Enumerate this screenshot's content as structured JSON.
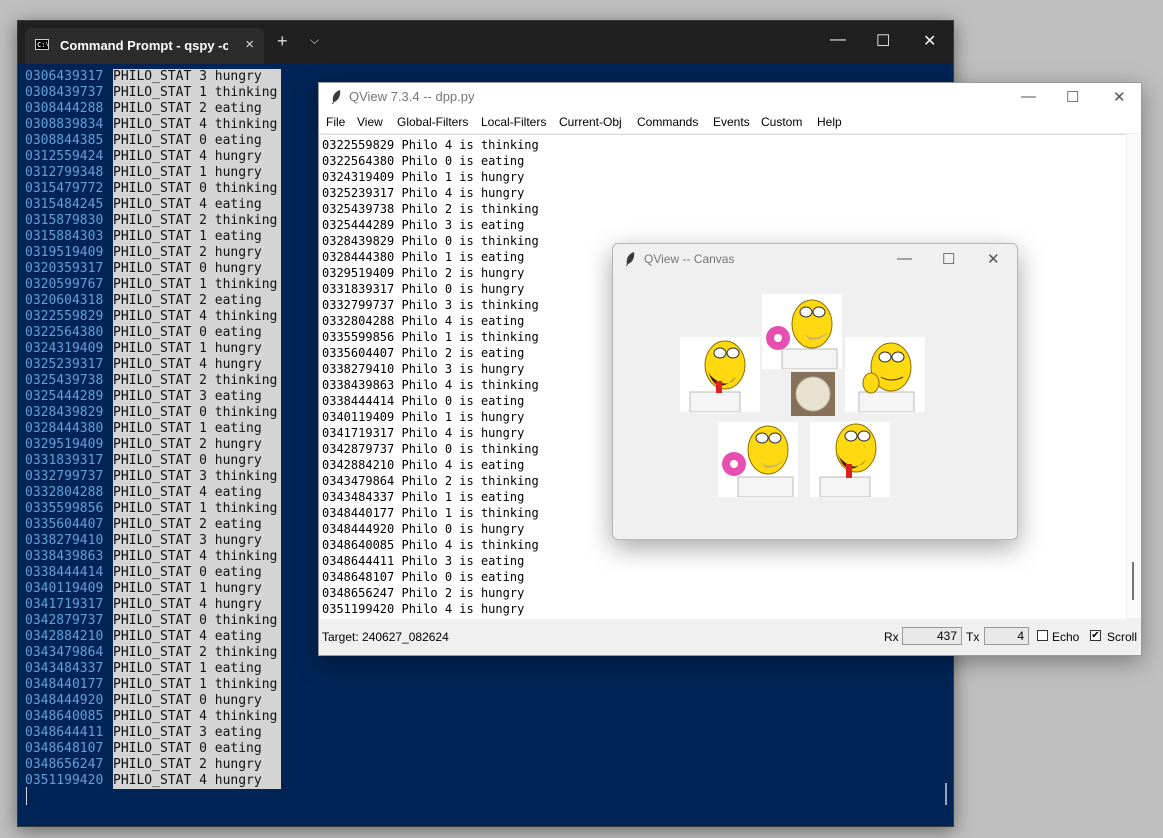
{
  "terminal": {
    "tab_title": "Command Prompt - qspy  -c C",
    "tab_close": "×",
    "new_tab": "+",
    "dropdown": "⌵",
    "minimize": "—",
    "maximize": "☐",
    "close": "✕",
    "rows": [
      {
        "ts": "0306439317",
        "msg": "PHILO_STAT 3 hungry"
      },
      {
        "ts": "0308439737",
        "msg": "PHILO_STAT 1 thinking"
      },
      {
        "ts": "0308444288",
        "msg": "PHILO_STAT 2 eating"
      },
      {
        "ts": "0308839834",
        "msg": "PHILO_STAT 4 thinking"
      },
      {
        "ts": "0308844385",
        "msg": "PHILO_STAT 0 eating"
      },
      {
        "ts": "0312559424",
        "msg": "PHILO_STAT 4 hungry"
      },
      {
        "ts": "0312799348",
        "msg": "PHILO_STAT 1 hungry"
      },
      {
        "ts": "0315479772",
        "msg": "PHILO_STAT 0 thinking"
      },
      {
        "ts": "0315484245",
        "msg": "PHILO_STAT 4 eating"
      },
      {
        "ts": "0315879830",
        "msg": "PHILO_STAT 2 thinking"
      },
      {
        "ts": "0315884303",
        "msg": "PHILO_STAT 1 eating"
      },
      {
        "ts": "0319519409",
        "msg": "PHILO_STAT 2 hungry"
      },
      {
        "ts": "0320359317",
        "msg": "PHILO_STAT 0 hungry"
      },
      {
        "ts": "0320599767",
        "msg": "PHILO_STAT 1 thinking"
      },
      {
        "ts": "0320604318",
        "msg": "PHILO_STAT 2 eating"
      },
      {
        "ts": "0322559829",
        "msg": "PHILO_STAT 4 thinking"
      },
      {
        "ts": "0322564380",
        "msg": "PHILO_STAT 0 eating"
      },
      {
        "ts": "0324319409",
        "msg": "PHILO_STAT 1 hungry"
      },
      {
        "ts": "0325239317",
        "msg": "PHILO_STAT 4 hungry"
      },
      {
        "ts": "0325439738",
        "msg": "PHILO_STAT 2 thinking"
      },
      {
        "ts": "0325444289",
        "msg": "PHILO_STAT 3 eating"
      },
      {
        "ts": "0328439829",
        "msg": "PHILO_STAT 0 thinking"
      },
      {
        "ts": "0328444380",
        "msg": "PHILO_STAT 1 eating"
      },
      {
        "ts": "0329519409",
        "msg": "PHILO_STAT 2 hungry"
      },
      {
        "ts": "0331839317",
        "msg": "PHILO_STAT 0 hungry"
      },
      {
        "ts": "0332799737",
        "msg": "PHILO_STAT 3 thinking"
      },
      {
        "ts": "0332804288",
        "msg": "PHILO_STAT 4 eating"
      },
      {
        "ts": "0335599856",
        "msg": "PHILO_STAT 1 thinking"
      },
      {
        "ts": "0335604407",
        "msg": "PHILO_STAT 2 eating"
      },
      {
        "ts": "0338279410",
        "msg": "PHILO_STAT 3 hungry"
      },
      {
        "ts": "0338439863",
        "msg": "PHILO_STAT 4 thinking"
      },
      {
        "ts": "0338444414",
        "msg": "PHILO_STAT 0 eating"
      },
      {
        "ts": "0340119409",
        "msg": "PHILO_STAT 1 hungry"
      },
      {
        "ts": "0341719317",
        "msg": "PHILO_STAT 4 hungry"
      },
      {
        "ts": "0342879737",
        "msg": "PHILO_STAT 0 thinking"
      },
      {
        "ts": "0342884210",
        "msg": "PHILO_STAT 4 eating"
      },
      {
        "ts": "0343479864",
        "msg": "PHILO_STAT 2 thinking"
      },
      {
        "ts": "0343484337",
        "msg": "PHILO_STAT 1 eating"
      },
      {
        "ts": "0348440177",
        "msg": "PHILO_STAT 1 thinking"
      },
      {
        "ts": "0348444920",
        "msg": "PHILO_STAT 0 hungry"
      },
      {
        "ts": "0348640085",
        "msg": "PHILO_STAT 4 thinking"
      },
      {
        "ts": "0348644411",
        "msg": "PHILO_STAT 3 eating"
      },
      {
        "ts": "0348648107",
        "msg": "PHILO_STAT 0 eating"
      },
      {
        "ts": "0348656247",
        "msg": "PHILO_STAT 2 hungry"
      },
      {
        "ts": "0351199420",
        "msg": "PHILO_STAT 4 hungry"
      }
    ]
  },
  "qview": {
    "title": "QView 7.3.4 -- dpp.py",
    "minimize": "—",
    "maximize": "☐",
    "close": "✕",
    "menu": [
      "File",
      "View",
      "Global-Filters",
      "Local-Filters",
      "Current-Obj",
      "Commands",
      "Events",
      "Custom",
      "Help"
    ],
    "log": [
      "0322559829 Philo 4 is thinking",
      "0322564380 Philo 0 is eating",
      "0324319409 Philo 1 is hungry",
      "0325239317 Philo 4 is hungry",
      "0325439738 Philo 2 is thinking",
      "0325444289 Philo 3 is eating",
      "0328439829 Philo 0 is thinking",
      "0328444380 Philo 1 is eating",
      "0329519409 Philo 2 is hungry",
      "0331839317 Philo 0 is hungry",
      "0332799737 Philo 3 is thinking",
      "0332804288 Philo 4 is eating",
      "0335599856 Philo 1 is thinking",
      "0335604407 Philo 2 is eating",
      "0338279410 Philo 3 is hungry",
      "0338439863 Philo 4 is thinking",
      "0338444414 Philo 0 is eating",
      "0340119409 Philo 1 is hungry",
      "0341719317 Philo 4 is hungry",
      "0342879737 Philo 0 is thinking",
      "0342884210 Philo 4 is eating",
      "0343479864 Philo 2 is thinking",
      "0343484337 Philo 1 is eating",
      "0348440177 Philo 1 is thinking",
      "0348444920 Philo 0 is hungry",
      "0348640085 Philo 4 is thinking",
      "0348644411 Philo 3 is eating",
      "0348648107 Philo 0 is eating",
      "0348656247 Philo 2 is hungry",
      "0351199420 Philo 4 is hungry"
    ],
    "status": {
      "target": "Target: 240627_082624",
      "rx_label": "Rx",
      "rx_value": "437",
      "tx_label": "Tx",
      "tx_value": "4",
      "echo_label": "Echo",
      "echo_checked": false,
      "scroll_label": "Scroll",
      "scroll_checked": true,
      "check_mark": "✔"
    }
  },
  "canvas": {
    "title": "QView -- Canvas",
    "minimize": "—",
    "maximize": "☐",
    "close": "✕",
    "philosophers": [
      "eating",
      "hungry",
      "thinking",
      "eating",
      "hungry"
    ]
  }
}
